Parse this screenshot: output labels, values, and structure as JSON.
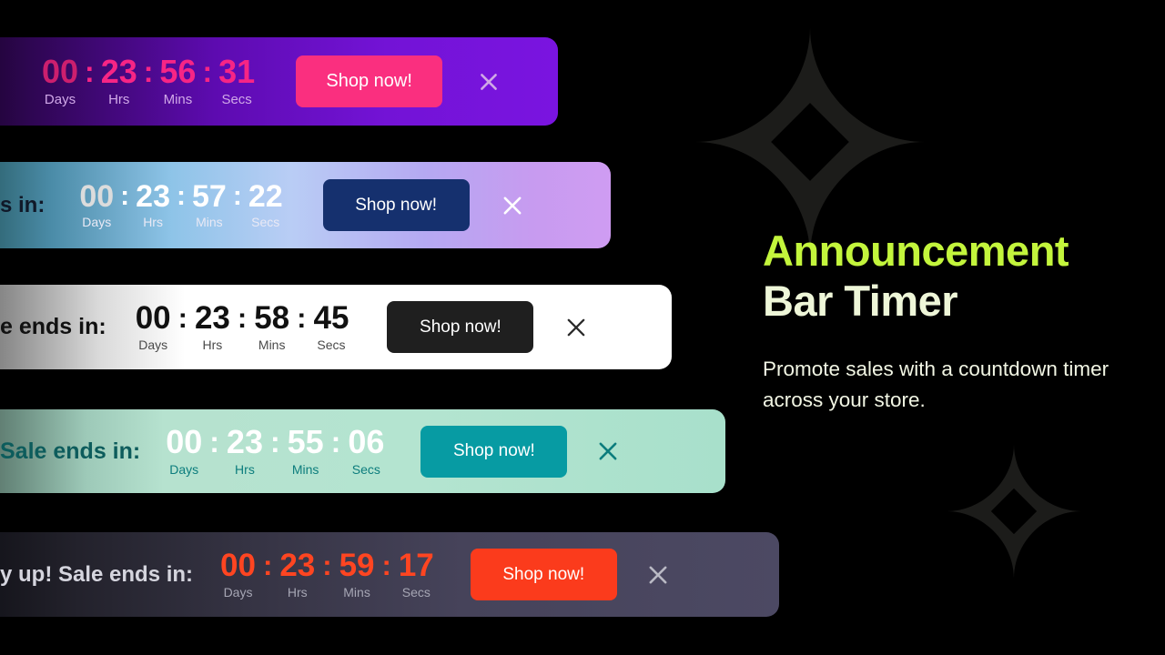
{
  "hero": {
    "title_line1": "Announcement",
    "title_line2": "Bar Timer",
    "subtitle": "Promote sales with a countdown timer across your store.",
    "accent_color": "#c3f53c",
    "title_line2_color": "#eef6d8",
    "subtitle_color": "#f2f6e4"
  },
  "labels": {
    "days": "Days",
    "hrs": "Hrs",
    "mins": "Mins",
    "secs": "Secs",
    "colon": ":",
    "close_icon": "close-icon"
  },
  "bars": [
    {
      "id": "bar1",
      "headline": "",
      "days": "00",
      "hrs": "23",
      "mins": "56",
      "secs": "31",
      "cta": "Shop now!",
      "background": "#5d0bb0",
      "cta_bg": "#fa2f7f",
      "number_color": "#f72585",
      "label_color": "#d0a8e8"
    },
    {
      "id": "bar2",
      "headline": "s in:",
      "days": "00",
      "hrs": "23",
      "mins": "57",
      "secs": "22",
      "cta": "Shop now!",
      "background": "#b9cdf5",
      "cta_bg": "#15306e",
      "number_color": "#ffffff",
      "label_color": "#e9e9f5"
    },
    {
      "id": "bar3",
      "headline": "e ends in:",
      "days": "00",
      "hrs": "23",
      "mins": "58",
      "secs": "45",
      "cta": "Shop now!",
      "background": "#ffffff",
      "cta_bg": "#1f1f1f",
      "number_color": "#111111",
      "label_color": "#4a4a4a"
    },
    {
      "id": "bar4",
      "headline": "Sale ends in:",
      "days": "00",
      "hrs": "23",
      "mins": "55",
      "secs": "06",
      "cta": "Shop now!",
      "background": "#b4e4d0",
      "cta_bg": "#079ba3",
      "number_color": "#ffffff",
      "label_color": "#0c7d7d"
    },
    {
      "id": "bar5",
      "headline": "y up! Sale ends in:",
      "days": "00",
      "hrs": "23",
      "mins": "59",
      "secs": "17",
      "cta": "Shop now!",
      "background": "#46435a",
      "cta_bg": "#fb3b1c",
      "number_color": "#ff4521",
      "label_color": "#a6a6b4"
    }
  ],
  "decor": {
    "sparkle_color": "#1c1c1a",
    "sparkle_top_name": "sparkle-icon",
    "sparkle_bottom_name": "sparkle-icon"
  }
}
